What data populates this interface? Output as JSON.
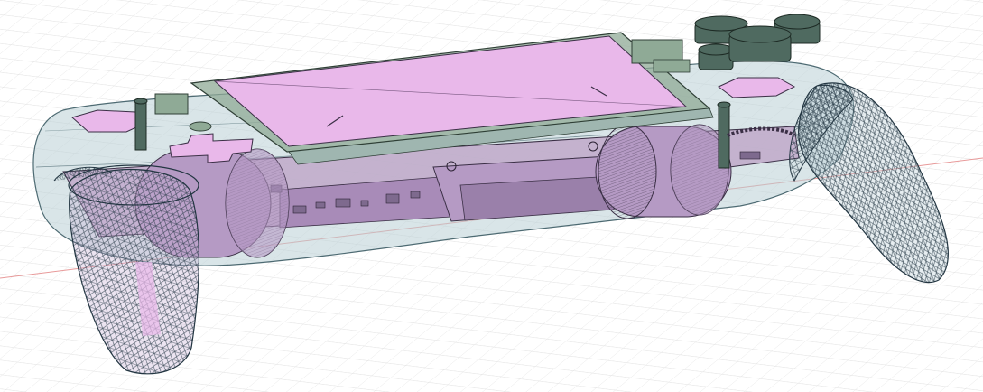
{
  "viewport": {
    "background": "#ffffff",
    "grid_color": "#d7d7d7",
    "axis_color": "#e89a9a"
  },
  "model": {
    "shell_fill": "#b9cfd6",
    "shell_stroke": "#4d6a72",
    "screen_color": "#e9b8ea",
    "bezel_color": "#8faa96",
    "component_fill": "#b59ac4",
    "component_stroke": "#3a2f45",
    "board_fill": "#bfa9c9",
    "button_fill": "#4f6a60",
    "button_stroke": "#1d2a24",
    "wireframe_color": "#233642",
    "grip_fill": "#c8b2d8"
  }
}
